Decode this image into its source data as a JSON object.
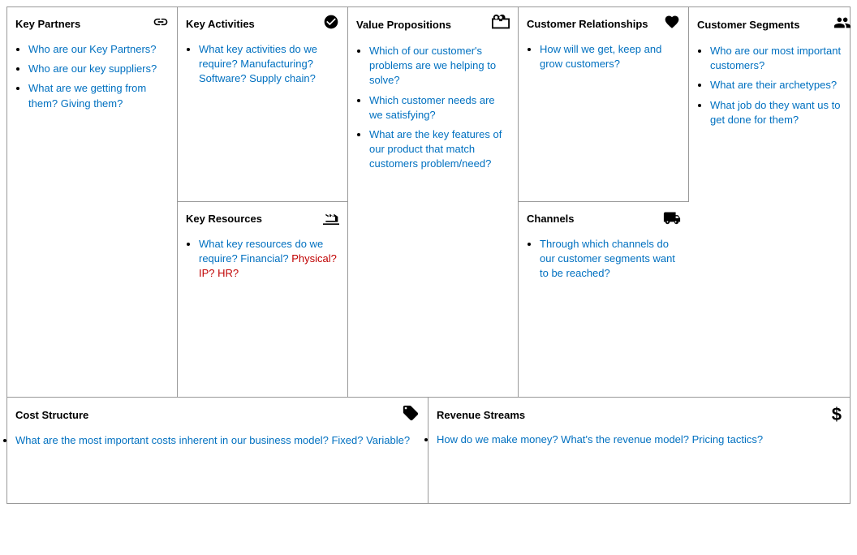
{
  "sections": {
    "keyPartners": {
      "title": "Key Partners",
      "items": [
        {
          "text": "Who are our Key Partners?",
          "color": "blue"
        },
        {
          "text": "Who are our key suppliers?",
          "color": "blue"
        },
        {
          "text": "What are we getting from them? Giving them?",
          "color": "blue"
        }
      ]
    },
    "keyActivities": {
      "title": "Key Activities",
      "items": [
        {
          "text_parts": [
            {
              "text": "What key activities do we require? Manufacturing? Software? Supply chain?",
              "color": "blue"
            }
          ]
        }
      ]
    },
    "keyResources": {
      "title": "Key Resources",
      "items": [
        {
          "text_parts": [
            {
              "text": "What key resources do we require? Financial? ",
              "color": "blue"
            },
            {
              "text": "Physical? IP? HR?",
              "color": "red"
            }
          ]
        }
      ]
    },
    "valuePropositions": {
      "title": "Value Propositions",
      "items": [
        {
          "text": "Which of our customer's problems are we helping to solve?",
          "color": "blue"
        },
        {
          "text": "Which customer needs are we satisfying?",
          "color": "blue"
        },
        {
          "text": "What are the key features of our product that match customers problem/need?",
          "color": "blue"
        }
      ]
    },
    "customerRelationships": {
      "title": "Customer Relationships",
      "items": [
        {
          "text": "How will we get, keep and grow customers?",
          "color": "blue"
        }
      ]
    },
    "channels": {
      "title": "Channels",
      "items": [
        {
          "text": "Through which channels do our customer segments want to be reached?",
          "color": "blue"
        }
      ]
    },
    "customerSegments": {
      "title": "Customer Segments",
      "items": [
        {
          "text": "Who are our most important customers?",
          "color": "blue"
        },
        {
          "text": "What are their archetypes?",
          "color": "blue"
        },
        {
          "text": "What job do they want us to get done for them?",
          "color": "blue"
        }
      ]
    },
    "costStructure": {
      "title": "Cost Structure",
      "items": [
        {
          "text": "What are the most important costs inherent in our business model? Fixed? Variable?",
          "color": "blue"
        }
      ]
    },
    "revenueStreams": {
      "title": "Revenue Streams",
      "items": [
        {
          "text": "How do we make money? What's the revenue model? Pricing tactics?",
          "color": "blue"
        }
      ]
    }
  }
}
